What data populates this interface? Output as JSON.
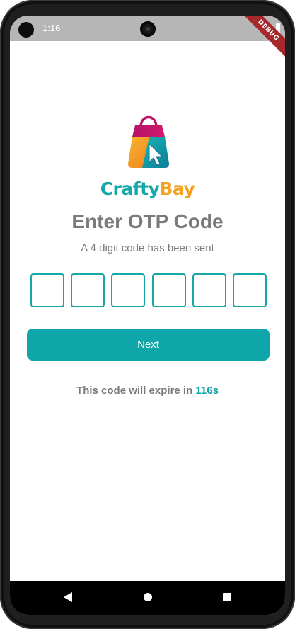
{
  "status_bar": {
    "time": "1:16",
    "debug_label": "DEBUG"
  },
  "brand": {
    "part1": "Crafty",
    "part2": "Bay",
    "colors": {
      "teal": "#15a8a8",
      "orange": "#f4a21e",
      "pink": "#c0136a"
    }
  },
  "otp": {
    "title": "Enter OTP Code",
    "subtitle": "A 4 digit code has been sent",
    "digits": [
      "",
      "",
      "",
      "",
      "",
      ""
    ]
  },
  "actions": {
    "next_label": "Next"
  },
  "expiry": {
    "prefix": "This code will expire in ",
    "countdown": "116s"
  },
  "accent": "#0ea6a8",
  "nav": {
    "back_icon": "back-icon",
    "home_icon": "home-icon",
    "recents_icon": "recents-icon"
  }
}
